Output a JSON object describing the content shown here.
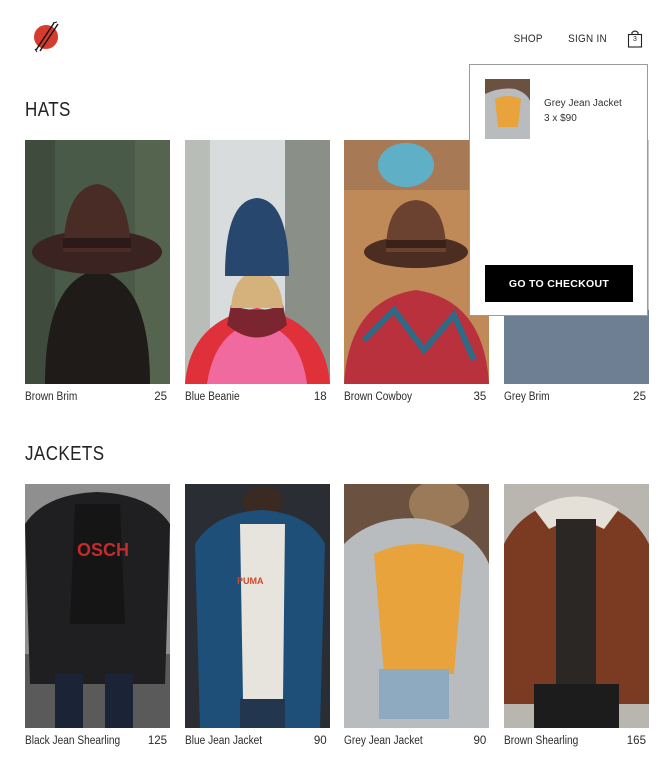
{
  "nav": {
    "shop": "SHOP",
    "sign_in": "SIGN IN",
    "cart_count": "3"
  },
  "colors": {
    "logo_red": "#d63b2f",
    "accent": "#000000"
  },
  "sections": [
    {
      "title": "HATS",
      "items": [
        {
          "name": "Brown Brim",
          "price": "25"
        },
        {
          "name": "Blue Beanie",
          "price": "18"
        },
        {
          "name": "Brown Cowboy",
          "price": "35"
        },
        {
          "name": "Grey Brim",
          "price": "25"
        }
      ]
    },
    {
      "title": "JACKETS",
      "items": [
        {
          "name": "Black Jean Shearling",
          "price": "125"
        },
        {
          "name": "Blue Jean Jacket",
          "price": "90"
        },
        {
          "name": "Grey Jean Jacket",
          "price": "90"
        },
        {
          "name": "Brown Shearling",
          "price": "165"
        }
      ]
    }
  ],
  "cart_dropdown": {
    "items": [
      {
        "name": "Grey Jean Jacket",
        "quantity_price": "3 x $90"
      }
    ],
    "checkout_label": "GO TO CHECKOUT"
  }
}
